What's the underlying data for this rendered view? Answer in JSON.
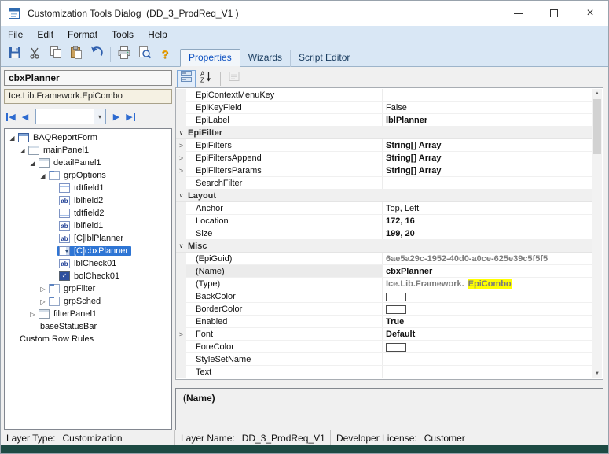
{
  "window": {
    "title": "Customization Tools Dialog  (DD_3_ProdReq_V1 )",
    "close_glyph": "×"
  },
  "menu": {
    "items": [
      "File",
      "Edit",
      "Format",
      "Tools",
      "Help"
    ]
  },
  "toolbar": {
    "buttons": [
      "save",
      "cut",
      "copy",
      "paste",
      "undo",
      "|",
      "print",
      "print-preview",
      "help"
    ]
  },
  "tabs": [
    {
      "label": "Properties",
      "selected": true
    },
    {
      "label": "Wizards",
      "selected": false
    },
    {
      "label": "Script Editor",
      "selected": false
    }
  ],
  "left": {
    "selected_control": "cbxPlanner",
    "selected_type": "Ice.Lib.Framework.EpiCombo",
    "nav": {
      "first": "◀",
      "prev": "◀",
      "next": "▶",
      "last": "▶",
      "dropdown": "▾"
    },
    "tree": [
      {
        "label": "BAQReportForm",
        "depth": 0,
        "icon": "form",
        "exp": "open"
      },
      {
        "label": "mainPanel1",
        "depth": 1,
        "icon": "panel",
        "exp": "open"
      },
      {
        "label": "detailPanel1",
        "depth": 2,
        "icon": "panel",
        "exp": "open"
      },
      {
        "label": "grpOptions",
        "depth": 3,
        "icon": "group",
        "exp": "open"
      },
      {
        "label": "tdtfield1",
        "depth": 4,
        "icon": "textfield"
      },
      {
        "label": "lblfield2",
        "depth": 4,
        "icon": "label"
      },
      {
        "label": "tdtfield2",
        "depth": 4,
        "icon": "textfield"
      },
      {
        "label": "lblfield1",
        "depth": 4,
        "icon": "label"
      },
      {
        "label": "[C]lblPlanner",
        "depth": 4,
        "icon": "label"
      },
      {
        "label": "[C]cbxPlanner",
        "depth": 4,
        "icon": "combo",
        "selected": true
      },
      {
        "label": "lblCheck01",
        "depth": 4,
        "icon": "label"
      },
      {
        "label": "bolCheck01",
        "depth": 4,
        "icon": "checkbox"
      },
      {
        "label": "grpFilter",
        "depth": 3,
        "icon": "group",
        "exp": "closed"
      },
      {
        "label": "grpSched",
        "depth": 3,
        "icon": "group",
        "exp": "closed"
      },
      {
        "label": "filterPanel1",
        "depth": 2,
        "icon": "panel",
        "exp": "closed"
      },
      {
        "label": "baseStatusBar",
        "depth": 2,
        "icon": "none"
      },
      {
        "label": "Custom Row Rules",
        "depth": 0,
        "icon": "none"
      }
    ]
  },
  "propgrid": {
    "toolbar": [
      {
        "name": "categorized",
        "pressed": true
      },
      {
        "name": "alphabetical"
      },
      {
        "name": "separator"
      },
      {
        "name": "property-pages",
        "disabled": true
      }
    ],
    "rows": [
      {
        "name": "EpiContextMenuKey",
        "value": ""
      },
      {
        "name": "EpiKeyField",
        "value": "False"
      },
      {
        "name": "EpiLabel",
        "value": "lblPlanner",
        "bold": true
      },
      {
        "kind": "category",
        "name": "EpiFilter"
      },
      {
        "name": "EpiFilters",
        "value": "String[] Array",
        "bold": true,
        "expand": true
      },
      {
        "name": "EpiFiltersAppend",
        "value": "String[] Array",
        "bold": true,
        "expand": true
      },
      {
        "name": "EpiFiltersParams",
        "value": "String[] Array",
        "bold": true,
        "expand": true
      },
      {
        "name": "SearchFilter",
        "value": ""
      },
      {
        "kind": "category",
        "name": "Layout"
      },
      {
        "name": "Anchor",
        "value": "Top, Left"
      },
      {
        "name": "Location",
        "value": "172, 16",
        "bold": true
      },
      {
        "name": "Size",
        "value": "199, 20",
        "bold": true
      },
      {
        "kind": "category",
        "name": "Misc"
      },
      {
        "name": "(EpiGuid)",
        "value": "6ae5a29c-1952-40d0-a0ce-625e39c5f5f5",
        "gray": true,
        "bold": true
      },
      {
        "name": "(Name)",
        "value": "cbxPlanner",
        "bold": true,
        "selected": true
      },
      {
        "name": "(Type)",
        "value_prefix": "Ice.Lib.Framework.",
        "value_highlight": "EpiCombo",
        "gray": true,
        "bold": true
      },
      {
        "name": "BackColor",
        "swatch": true
      },
      {
        "name": "BorderColor",
        "swatch": true
      },
      {
        "name": "Enabled",
        "value": "True",
        "bold": true
      },
      {
        "name": "Font",
        "value": "Default",
        "bold": true,
        "expand": true
      },
      {
        "name": "ForeColor",
        "swatch": true
      },
      {
        "name": "StyleSetName",
        "value": ""
      },
      {
        "name": "Text",
        "value": ""
      }
    ],
    "description_title": "(Name)",
    "highlight_color": "#ffff00"
  },
  "statusbar": {
    "layer_type_label": "Layer Type:",
    "layer_type_value": "Customization",
    "layer_name_label": "Layer Name:",
    "layer_name_value": "DD_3_ProdReq_V1",
    "license_label": "Developer License:",
    "license_value": "Customer"
  },
  "icons": {
    "expanded": "◢",
    "collapsed": "▷",
    "category_chevron": "∨",
    "row_expand": ">",
    "check": "✓",
    "label_glyph": "ab",
    "combo_arrow": "▾",
    "help_glyph": "?",
    "scroll_up": "▲",
    "scroll_down": "▼"
  }
}
